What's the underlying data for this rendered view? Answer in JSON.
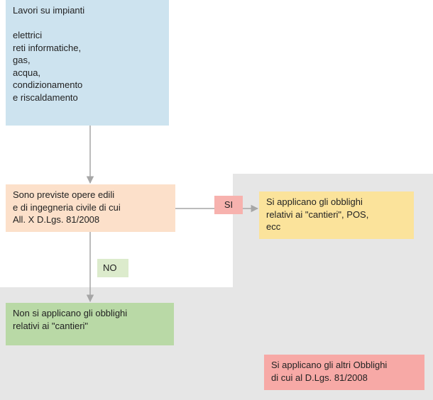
{
  "nodes": {
    "start": {
      "line1": "Lavori su impianti",
      "line2": "elettrici",
      "line3": "reti informatiche,",
      "line4": "gas,",
      "line5": "acqua,",
      "line6": "condizionamento",
      "line7": "e riscaldamento"
    },
    "decision": {
      "line1": "Sono previste opere edili",
      "line2": "e di ingegneria civile di cui",
      "line3": "All. X D.Lgs. 81/2008"
    },
    "si_label": "SI",
    "no_label": "NO",
    "cantieri_yes": {
      "line1": "Si applicano gli obblighi",
      "line2": "relativi ai \"cantieri\", POS,",
      "line3": "ecc"
    },
    "cantieri_no": {
      "line1": "Non si applicano gli obblighi",
      "line2": "relativi ai \"cantieri\""
    },
    "altri": {
      "line1": "Si applicano gli altri Obblighi",
      "line2": "di cui al D.Lgs. 81/2008"
    }
  }
}
